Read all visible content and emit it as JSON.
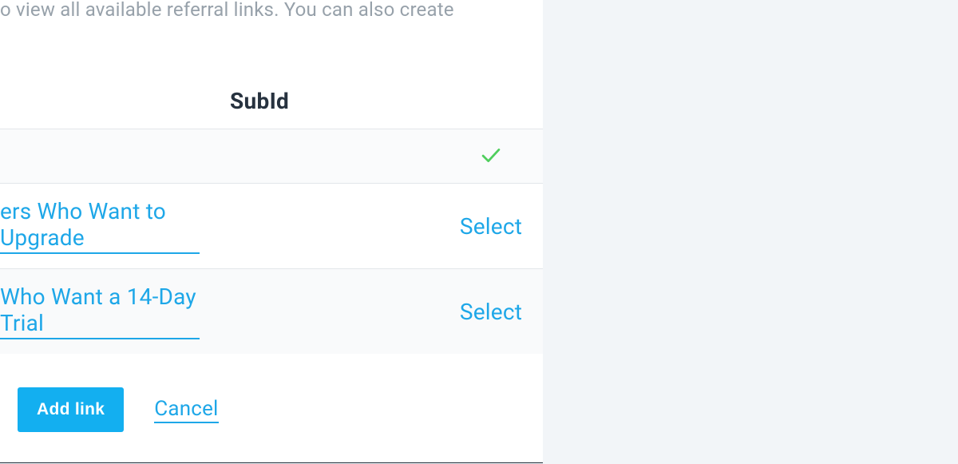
{
  "description_fragment": "o view all available referral links. You can also create",
  "table": {
    "header_subid": "SubId",
    "rows": [
      {
        "name": "",
        "selected": true
      },
      {
        "name": "ers Who Want to Upgrade",
        "selected": false,
        "action": "Select"
      },
      {
        "name": " Who Want a 14-Day Trial",
        "selected": false,
        "action": "Select"
      }
    ]
  },
  "actions": {
    "add_link": "Add link",
    "cancel": "Cancel"
  }
}
